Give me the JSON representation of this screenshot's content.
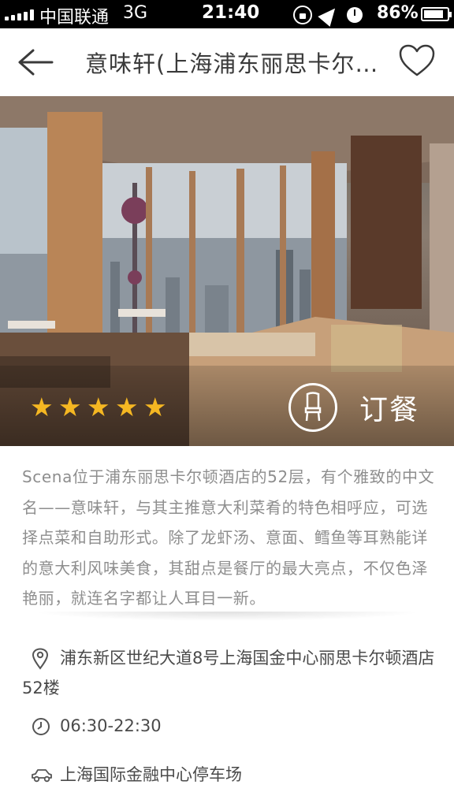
{
  "status_bar": {
    "carrier": "中国联通",
    "network": "3G",
    "time": "21:40",
    "battery": "86%"
  },
  "header": {
    "title": "意味轩(上海浦东丽思卡尔顿酒店)"
  },
  "hero": {
    "rating_stars": 5,
    "order_label": "订餐",
    "star_color": "#f5b722"
  },
  "description": "Scena位于浦东丽思卡尔顿酒店的52层，有个雅致的中文名——意味轩，与其主推意大利菜肴的特色相呼应，可选择点菜和自助形式。除了龙虾汤、意面、鳕鱼等耳熟能详的意大利风味美食，其甜点是餐厅的最大亮点，不仅色泽艳丽，就连名字都让人耳目一新。",
  "info": {
    "address": "浦东新区世纪大道8号上海国金中心丽思卡尔顿酒店52楼",
    "hours": "06:30-22:30",
    "parking": "上海国际金融中心停车场"
  },
  "icons": {
    "back": "back-arrow-icon",
    "favorite": "heart-icon",
    "order": "chair-icon",
    "location": "location-pin-icon",
    "clock": "clock-icon",
    "car": "car-icon"
  }
}
